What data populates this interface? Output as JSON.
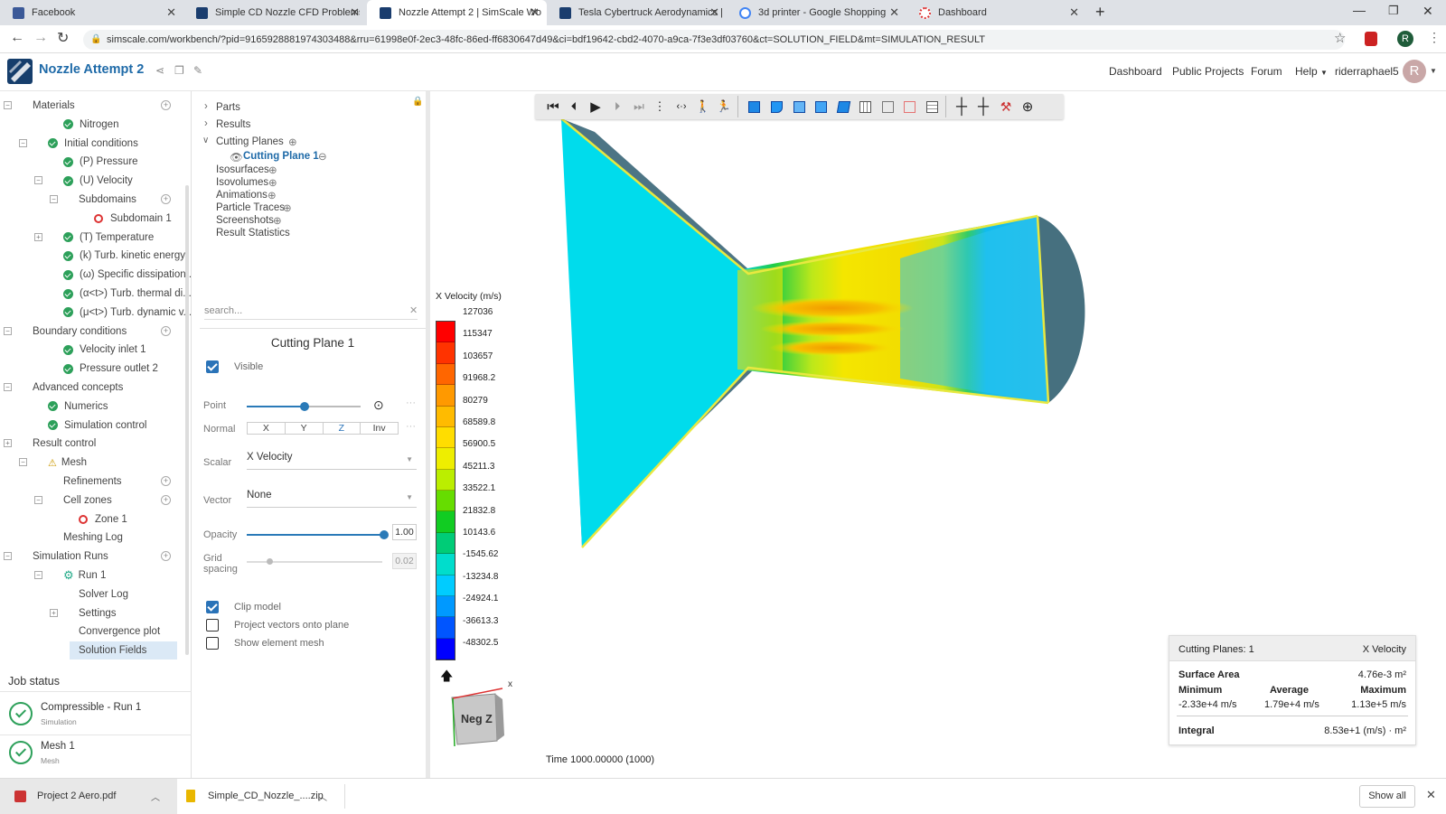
{
  "browser": {
    "tabs": [
      {
        "title": "Facebook",
        "color": "#3b5998"
      },
      {
        "title": "Simple CD Nozzle CFD Problems",
        "color": "#1a3d6e"
      },
      {
        "title": "Nozzle Attempt 2 | SimScale Wo",
        "color": "#1a3d6e"
      },
      {
        "title": "Tesla Cybertruck Aerodynamics |",
        "color": "#1a3d6e"
      },
      {
        "title": "3d printer - Google Shopping",
        "color": "#4285f4"
      },
      {
        "title": "Dashboard",
        "color": "#d33"
      }
    ],
    "url": "simscale.com/workbench/?pid=9165928881974303488&rru=61998e0f-2ec3-48fc-86ed-ff6830647d49&ci=bdf19642-cbd2-4070-a9ca-7f3e3df03760&ct=SOLUTION_FIELD&mt=SIMULATION_RESULT",
    "profile_letter": "R"
  },
  "app": {
    "title": "Nozzle Attempt 2",
    "nav": [
      "Dashboard",
      "Public Projects",
      "Forum",
      "Help"
    ],
    "user": "riderraphael5",
    "avatar": "R"
  },
  "tree": [
    {
      "label": "Materials",
      "indent": 0,
      "icon": "none"
    },
    {
      "label": "Nitrogen",
      "indent": 2,
      "icon": "check"
    },
    {
      "label": "Initial conditions",
      "indent": 1,
      "icon": "check"
    },
    {
      "label": "(P) Pressure",
      "indent": 2,
      "icon": "check"
    },
    {
      "label": "(U) Velocity",
      "indent": 2,
      "icon": "check"
    },
    {
      "label": "Subdomains",
      "indent": 3,
      "icon": "none"
    },
    {
      "label": "Subdomain 1",
      "indent": 4,
      "icon": "ring"
    },
    {
      "label": "(T) Temperature",
      "indent": 2,
      "icon": "check"
    },
    {
      "label": "(k) Turb. kinetic energy",
      "indent": 2,
      "icon": "check"
    },
    {
      "label": "(ω) Specific dissipation...",
      "indent": 2,
      "icon": "check"
    },
    {
      "label": "(α<t>) Turb. thermal di...",
      "indent": 2,
      "icon": "check"
    },
    {
      "label": "(μ<t>) Turb. dynamic v...",
      "indent": 2,
      "icon": "check"
    },
    {
      "label": "Boundary conditions",
      "indent": 0,
      "icon": "none"
    },
    {
      "label": "Velocity inlet 1",
      "indent": 2,
      "icon": "check"
    },
    {
      "label": "Pressure outlet 2",
      "indent": 2,
      "icon": "check"
    },
    {
      "label": "Advanced concepts",
      "indent": 0,
      "icon": "none"
    },
    {
      "label": "Numerics",
      "indent": 1,
      "icon": "check"
    },
    {
      "label": "Simulation control",
      "indent": 1,
      "icon": "check"
    },
    {
      "label": "Result control",
      "indent": 0,
      "icon": "none"
    },
    {
      "label": "Mesh",
      "indent": 1,
      "icon": "mesh"
    },
    {
      "label": "Refinements",
      "indent": 2,
      "icon": "none"
    },
    {
      "label": "Cell zones",
      "indent": 2,
      "icon": "none"
    },
    {
      "label": "Zone 1",
      "indent": 3,
      "icon": "ring"
    },
    {
      "label": "Meshing Log",
      "indent": 2,
      "icon": "none"
    },
    {
      "label": "Simulation Runs",
      "indent": 0,
      "icon": "none"
    },
    {
      "label": "Run 1",
      "indent": 2,
      "icon": "gear"
    },
    {
      "label": "Solver Log",
      "indent": 3,
      "icon": "none"
    },
    {
      "label": "Settings",
      "indent": 3,
      "icon": "none"
    },
    {
      "label": "Convergence plot",
      "indent": 3,
      "icon": "none"
    },
    {
      "label": "Solution Fields",
      "indent": 3,
      "icon": "none",
      "selected": true
    }
  ],
  "jobs": {
    "title": "Job status",
    "items": [
      {
        "name": "Compressible - Run 1",
        "type": "Simulation"
      },
      {
        "name": "Mesh 1",
        "type": "Mesh"
      }
    ]
  },
  "results_tree": {
    "parts": "Parts",
    "results": "Results",
    "cutting_planes": "Cutting Planes",
    "cutting_plane_1": "Cutting Plane 1",
    "isosurfaces": "Isosurfaces",
    "isovolumes": "Isovolumes",
    "animations": "Animations",
    "particle_traces": "Particle Traces",
    "screenshots": "Screenshots",
    "result_statistics": "Result Statistics",
    "search_placeholder": "search..."
  },
  "panel": {
    "title": "Cutting Plane 1",
    "visible": "Visible",
    "point": "Point",
    "normal": "Normal",
    "normal_options": [
      "X",
      "Y",
      "Z",
      "Inv"
    ],
    "normal_selected": "Z",
    "scalar_label": "Scalar",
    "scalar_value": "X Velocity",
    "vector_label": "Vector",
    "vector_value": "None",
    "opacity_label": "Opacity",
    "opacity_value": "1.00",
    "grid_label": "Grid spacing",
    "grid_value": "0.02",
    "clip_model": "Clip model",
    "project_vectors": "Project vectors onto plane",
    "show_mesh": "Show element mesh"
  },
  "legend": {
    "title": "X Velocity (m/s)",
    "ticks": [
      "127036",
      "115347",
      "103657",
      "91968.2",
      "80279",
      "68589.8",
      "56900.5",
      "45211.3",
      "33522.1",
      "21832.8",
      "10143.6",
      "-1545.62",
      "-13234.8",
      "-24924.1",
      "-36613.3",
      "-48302.5"
    ],
    "colors": [
      "#ff0000",
      "#ff3300",
      "#ff6600",
      "#ff9900",
      "#ffbb00",
      "#ffdd00",
      "#eeee00",
      "#bbee00",
      "#66dd00",
      "#11cc22",
      "#00cc77",
      "#00ddcc",
      "#00ccff",
      "#0099ff",
      "#0055ff",
      "#0000ff"
    ]
  },
  "viewport": {
    "axis_label": "Neg Z",
    "axis_x": "x",
    "time": "Time 1000.00000 (1000)"
  },
  "stats": {
    "header_left": "Cutting Planes: 1",
    "header_right": "X Velocity",
    "surface_area_label": "Surface Area",
    "surface_area": "4.76e-3 m²",
    "min_label": "Minimum",
    "avg_label": "Average",
    "max_label": "Maximum",
    "min": "-2.33e+4 m/s",
    "avg": "1.79e+4 m/s",
    "max": "1.13e+5 m/s",
    "integral_label": "Integral",
    "integral": "8.53e+1 (m/s) · m²"
  },
  "downloads": {
    "items": [
      "Project 2 Aero.pdf",
      "Simple_CD_Nozzle_....zip"
    ],
    "show_all": "Show all"
  }
}
